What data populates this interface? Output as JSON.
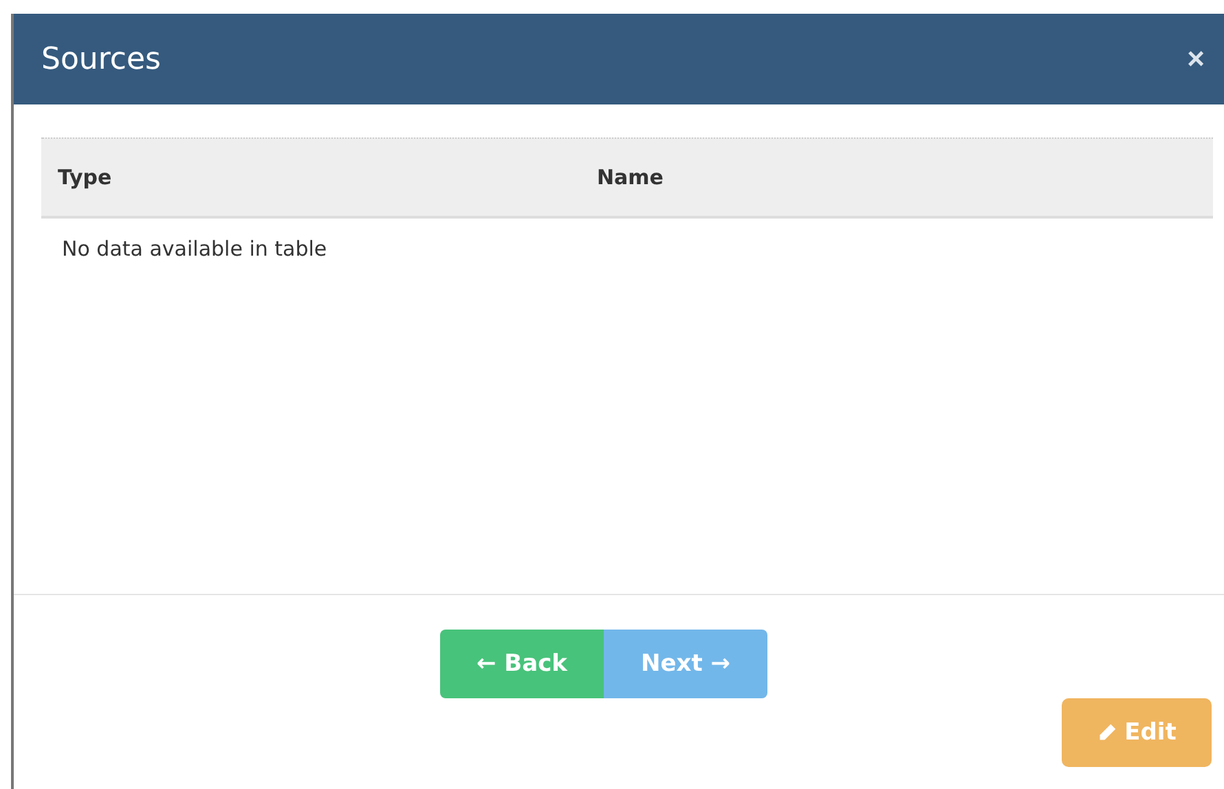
{
  "dialog": {
    "title": "Sources",
    "close": "×"
  },
  "table": {
    "columns": [
      "Type",
      "Name"
    ],
    "empty_message": "No data available in table"
  },
  "buttons": [
    {
      "kind": "back",
      "arrow": "←",
      "label": "Back"
    },
    {
      "kind": "next",
      "arrow": "→",
      "label": "Next"
    }
  ],
  "edit_button": {
    "label": "Edit"
  }
}
